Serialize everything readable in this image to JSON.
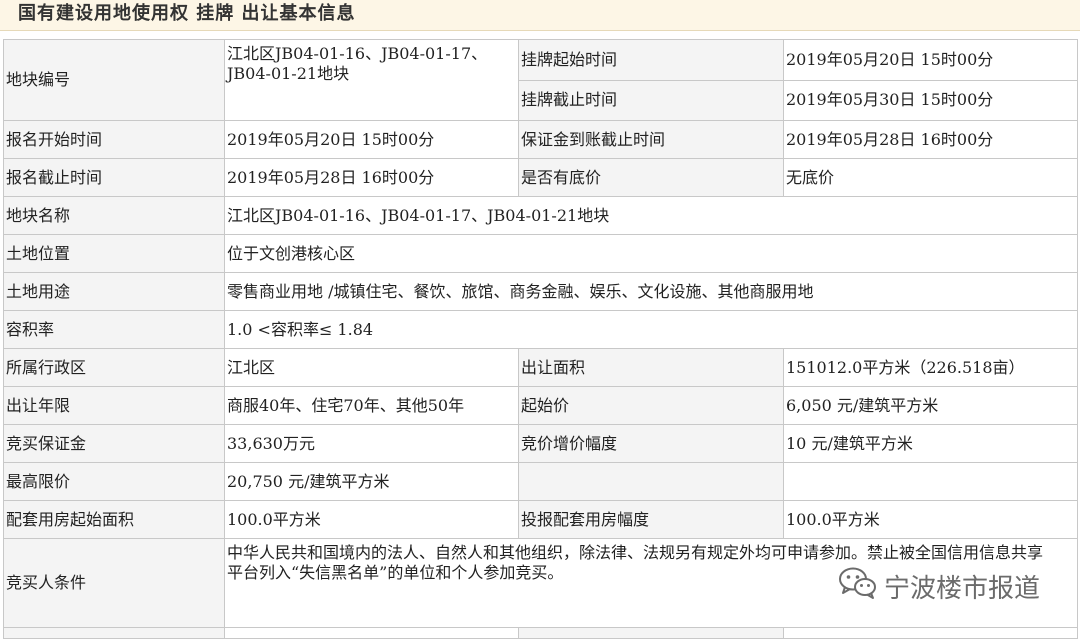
{
  "header": {
    "title": "国有建设用地使用权 挂牌 出让基本信息"
  },
  "rows": {
    "parcel_no": {
      "label": "地块编号",
      "value": "江北区JB04-01-16、JB04-01-17、JB04-01-21地块"
    },
    "listing_start": {
      "label": "挂牌起始时间",
      "value": "2019年05月20日 15时00分"
    },
    "listing_end": {
      "label": "挂牌截止时间",
      "value": "2019年05月30日 15时00分"
    },
    "reg_start": {
      "label": "报名开始时间",
      "value": "2019年05月20日 15时00分"
    },
    "deposit_deadline": {
      "label": "保证金到账截止时间",
      "value": "2019年05月28日 16时00分"
    },
    "reg_end": {
      "label": "报名截止时间",
      "value": "2019年05月28日 16时00分"
    },
    "reserve_price": {
      "label": "是否有底价",
      "value": "无底价"
    },
    "parcel_name": {
      "label": "地块名称",
      "value": "江北区JB04-01-16、JB04-01-17、JB04-01-21地块"
    },
    "location": {
      "label": "土地位置",
      "value": "位于文创港核心区"
    },
    "usage": {
      "label": "土地用途",
      "value": "零售商业用地 /城镇住宅、餐饮、旅馆、商务金融、娱乐、文化设施、其他商服用地"
    },
    "far": {
      "label": "容积率",
      "value": "1.0 <容积率≤ 1.84"
    },
    "district": {
      "label": "所属行政区",
      "value": "江北区"
    },
    "area": {
      "label": "出让面积",
      "value": "151012.0平方米（226.518亩）"
    },
    "term": {
      "label": "出让年限",
      "value": "商服40年、住宅70年、其他50年"
    },
    "start_price": {
      "label": "起始价",
      "value": "6,050 元/建筑平方米"
    },
    "bid_deposit": {
      "label": "竞买保证金",
      "value": "33,630万元"
    },
    "increment": {
      "label": "竞价增价幅度",
      "value": "10 元/建筑平方米"
    },
    "max_price": {
      "label": "最高限价",
      "value": "20,750 元/建筑平方米"
    },
    "housing_start": {
      "label": "配套用房起始面积",
      "value": "100.0平方米"
    },
    "housing_step": {
      "label": "投报配套用房幅度",
      "value": "100.0平方米"
    },
    "conditions": {
      "label": "竞买人条件",
      "value": "中华人民共和国境内的法人、自然人和其他组织，除法律、法规另有规定外均可申请参加。禁止被全国信用信息共享平台列入“失信黑名单”的单位和个人参加竞买。"
    }
  },
  "watermark": {
    "text": "宁波楼市报道",
    "icon": "wechat-icon"
  }
}
